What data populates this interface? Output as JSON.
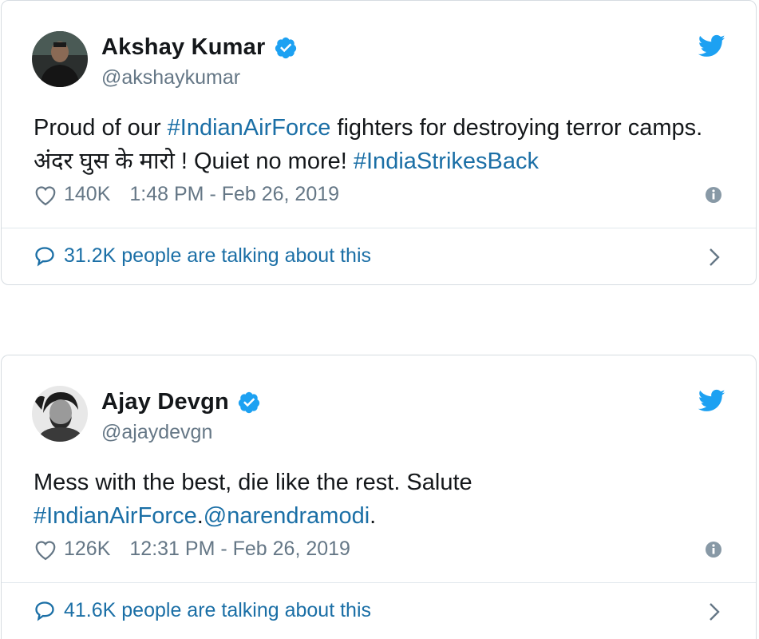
{
  "colors": {
    "link": "#1b6fa6",
    "twitter_blue": "#1da1f2",
    "text": "#14171a",
    "muted": "#657786",
    "border": "#d6dce1"
  },
  "tweets": [
    {
      "author": {
        "name": "Akshay Kumar",
        "handle": "@akshaykumar",
        "verified": true,
        "avatar_icon": "avatar-photo"
      },
      "text": {
        "part1": "Proud of our ",
        "hashtag1": "#IndianAirForce",
        "part2": " fighters for destroying terror camps. अंदर घुस के मारो ! Quiet no more! ",
        "hashtag2": "#IndiaStrikesBack"
      },
      "likes": "140K",
      "timestamp": "1:48 PM - Feb 26, 2019",
      "talking": "31.2K people are talking about this"
    },
    {
      "author": {
        "name": "Ajay Devgn",
        "handle": "@ajaydevgn",
        "verified": true,
        "avatar_icon": "avatar-photo"
      },
      "text": {
        "part1": "Mess with the best, die like the rest. Salute ",
        "hashtag1": "#IndianAirForce",
        "part2": ".",
        "mention1": "@narendramodi",
        "part3": "."
      },
      "likes": "126K",
      "timestamp": "12:31 PM - Feb 26, 2019",
      "talking": "41.6K people are talking about this"
    }
  ]
}
